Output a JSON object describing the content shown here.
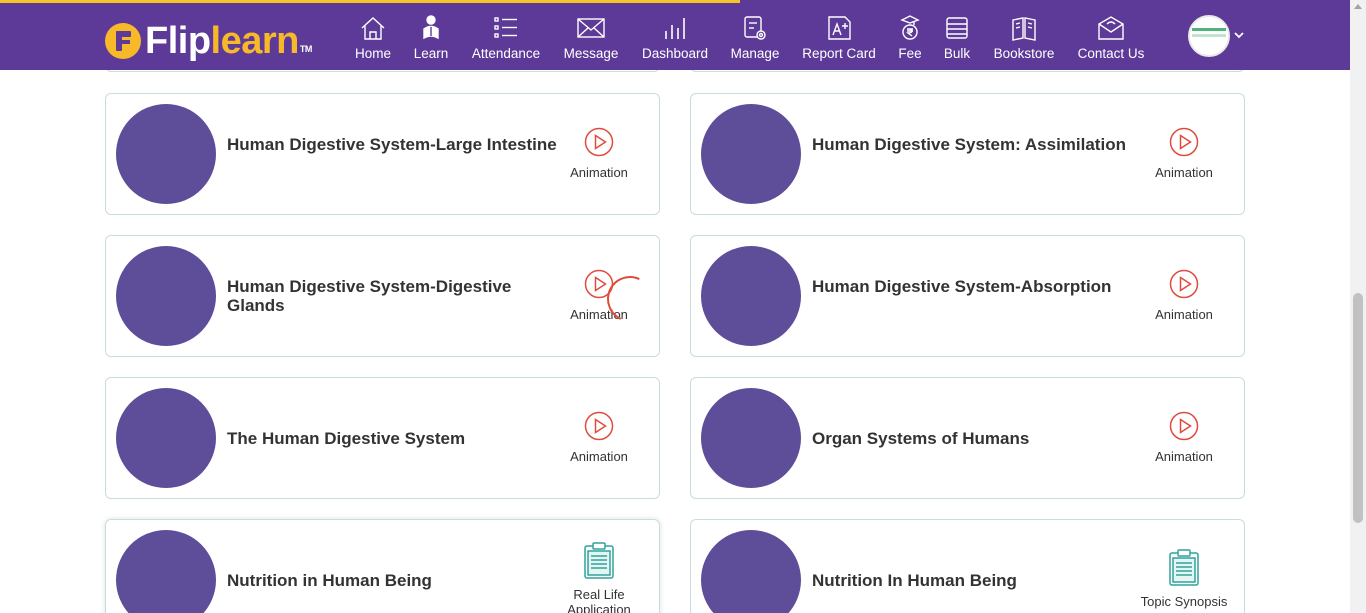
{
  "brand": {
    "name_part1": "Flip",
    "name_part2": "learn",
    "trademark": "TM"
  },
  "nav": [
    {
      "id": "home",
      "label": "Home",
      "icon": "home-icon"
    },
    {
      "id": "learn",
      "label": "Learn",
      "icon": "learn-icon"
    },
    {
      "id": "attendance",
      "label": "Attendance",
      "icon": "attendance-list-icon"
    },
    {
      "id": "message",
      "label": "Message",
      "icon": "envelope-icon"
    },
    {
      "id": "dashboard",
      "label": "Dashboard",
      "icon": "bar-chart-icon"
    },
    {
      "id": "manage",
      "label": "Manage",
      "icon": "manage-gear-icon"
    },
    {
      "id": "report-card",
      "label": "Report Card",
      "icon": "report-card-icon"
    },
    {
      "id": "fee",
      "label": "Fee",
      "icon": "fee-rupee-icon"
    },
    {
      "id": "bulk",
      "label": "Bulk",
      "icon": "bulk-stack-icon"
    },
    {
      "id": "bookstore",
      "label": "Bookstore",
      "icon": "book-icon"
    },
    {
      "id": "contact-us",
      "label": "Contact Us",
      "icon": "contact-envelope-icon"
    }
  ],
  "colors": {
    "header": "#5e3a98",
    "accent_yellow": "#f7b82a",
    "thumbnail": "#5e4d98",
    "play_red": "#e04b3d",
    "doc_teal": "#2fa39a",
    "card_border": "#c8dde0"
  },
  "cards": [
    {
      "title": "Human Digestive System-Large Intestine",
      "action": "Animation",
      "action_icon": "play-circle-icon"
    },
    {
      "title": "Human Digestive System: Assimilation",
      "action": "Animation",
      "action_icon": "play-circle-icon"
    },
    {
      "title": "Human Digestive System-Digestive Glands",
      "action": "Animation",
      "action_icon": "play-circle-icon"
    },
    {
      "title": "Human Digestive System-Absorption",
      "action": "Animation",
      "action_icon": "play-circle-icon"
    },
    {
      "title": "The Human Digestive System",
      "action": "Animation",
      "action_icon": "play-circle-icon"
    },
    {
      "title": "Organ Systems of Humans",
      "action": "Animation",
      "action_icon": "play-circle-icon"
    },
    {
      "title": "Nutrition in Human Being",
      "action": "Real Life Application",
      "action_icon": "clipboard-document-icon"
    },
    {
      "title": "Nutrition In Human Being",
      "action": "Topic Synopsis",
      "action_icon": "clipboard-document-icon"
    }
  ]
}
